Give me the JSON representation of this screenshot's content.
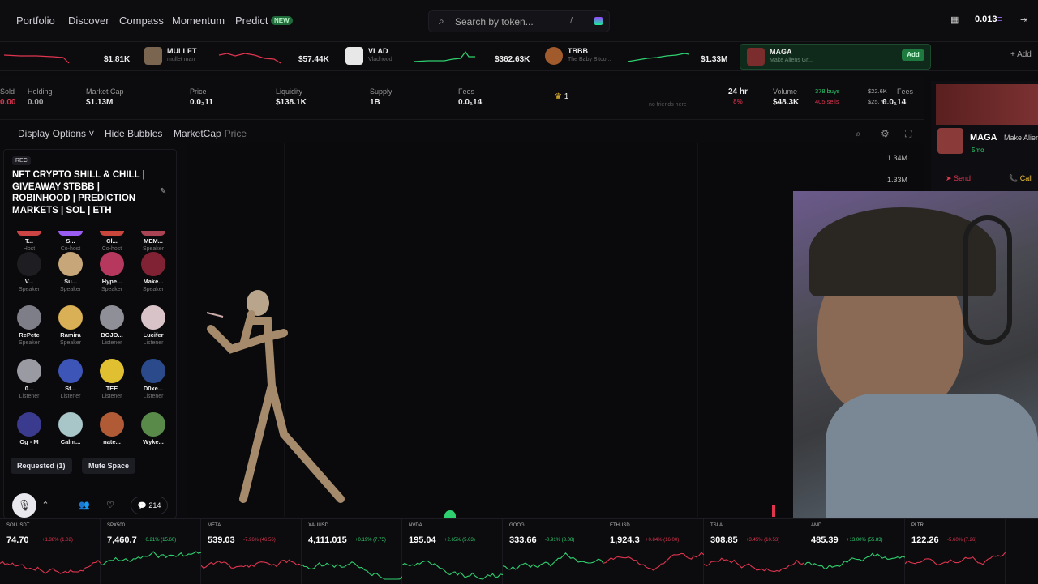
{
  "nav": {
    "items": [
      "Portfolio",
      "Discover",
      "Compass",
      "Momentum",
      "Predict"
    ],
    "new_badge": "NEW",
    "search_placeholder": "Search by token...",
    "search_shortcut": "/",
    "balance": "0.013"
  },
  "ticker": [
    {
      "name": "",
      "sub": "",
      "mc": "$1.81K",
      "trend": "down"
    },
    {
      "name": "MULLET",
      "sub": "mullet man",
      "mc": "$57.44K",
      "trend": "down"
    },
    {
      "name": "VLAD",
      "sub": "Vladhood",
      "mc": "$362.63K",
      "trend": "up"
    },
    {
      "name": "TBBB",
      "sub": "The Baby Bitco...",
      "mc": "$1.33M",
      "trend": "up"
    },
    {
      "name": "MAGA",
      "sub": "Make Aliens Gr...",
      "mc": "",
      "trend": "flat"
    }
  ],
  "ticker_add": "Add",
  "ticker_add_more": "Add",
  "stats": {
    "sold_label": "Sold",
    "sold_value": "0.00",
    "holding_label": "Holding",
    "holding_value": "0.00",
    "mcap_label": "Market Cap",
    "mcap_value": "$1.13M",
    "price_label": "Price",
    "price_value": "0.0₂11",
    "liq_label": "Liquidity",
    "liq_value": "$138.1K",
    "supply_label": "Supply",
    "supply_value": "1B",
    "fees_label": "Fees",
    "fees_value": "0.0₁14",
    "holders_count": "1",
    "friends": "no friends here",
    "period": "24 hr",
    "period_change": "8%",
    "volume_label": "Volume",
    "volume_value": "$48.3K",
    "buys": "378 buys",
    "buys_value": "$22.6K",
    "sells": "405 sells",
    "sells_value": "$25.7K",
    "fees2_label": "Fees",
    "fees2_value": "0.0₁14"
  },
  "toolbar": {
    "display_options": "Display Options",
    "hide_bubbles": "Hide Bubbles",
    "mcap": "MarketCap",
    "price": "/ Price"
  },
  "chart": {
    "y_labels": [
      "1.34M",
      "1.33M"
    ]
  },
  "space": {
    "rec": "REC",
    "title": "NFT CRYPTO SHILL & CHILL | GIVEAWAY $TBBB | ROBINHOOD | PREDICTION MARKETS | SOL | ETH",
    "speakers": [
      {
        "name": "T...",
        "role": "Host"
      },
      {
        "name": "S...",
        "role": "Co-host"
      },
      {
        "name": "Cl...",
        "role": "Co-host"
      },
      {
        "name": "MEM...",
        "role": "Speaker"
      },
      {
        "name": "V...",
        "role": "Speaker"
      },
      {
        "name": "Su...",
        "role": "Speaker"
      },
      {
        "name": "Hype...",
        "role": "Speaker"
      },
      {
        "name": "Make...",
        "role": "Speaker"
      },
      {
        "name": "RePete",
        "role": "Speaker"
      },
      {
        "name": "Ramira",
        "role": "Speaker"
      },
      {
        "name": "BOJO...",
        "role": "Listener"
      },
      {
        "name": "Lucifer",
        "role": "Listener"
      },
      {
        "name": "0...",
        "role": "Listener"
      },
      {
        "name": "St...",
        "role": "Listener"
      },
      {
        "name": "TEE",
        "role": "Listener"
      },
      {
        "name": "D0xe...",
        "role": "Listener"
      },
      {
        "name": "Og - M",
        "role": ""
      },
      {
        "name": "Calm...",
        "role": ""
      },
      {
        "name": "nate...",
        "role": ""
      },
      {
        "name": "Wyke...",
        "role": ""
      }
    ],
    "requested": "Requested (1)",
    "mute": "Mute Space",
    "comments": "214"
  },
  "side": {
    "name": "MAGA",
    "sub": "Make Alien",
    "age": "5mo",
    "send": "Send",
    "call": "Call"
  },
  "bottom": [
    {
      "ticker": "SOLUSDT",
      "price": "74.70",
      "change": "+1.38% (1.02)",
      "color": "#e0354f"
    },
    {
      "ticker": "SPX500",
      "price": "7,460.7",
      "change": "+0.21% (15.60)",
      "color": "#2fd06f"
    },
    {
      "ticker": "META",
      "price": "539.03",
      "change": "-7.96% (46.56)",
      "color": "#e0354f"
    },
    {
      "ticker": "XAUUSD",
      "price": "4,111.015",
      "change": "+0.19% (7.75)",
      "color": "#2fd06f"
    },
    {
      "ticker": "NVDA",
      "price": "195.04",
      "change": "+2.65% (5.03)",
      "color": "#2fd06f"
    },
    {
      "ticker": "GOOGL",
      "price": "333.66",
      "change": "-0.91% (3.08)",
      "color": "#2fd06f"
    },
    {
      "ticker": "ETHUSD",
      "price": "1,924.3",
      "change": "+0.84% (16.00)",
      "color": "#e0354f"
    },
    {
      "ticker": "TSLA",
      "price": "308.85",
      "change": "+3.45% (10.53)",
      "color": "#e0354f"
    },
    {
      "ticker": "AMD",
      "price": "485.39",
      "change": "+13.00% (55.83)",
      "color": "#2fd06f"
    },
    {
      "ticker": "PLTR",
      "price": "122.26",
      "change": "-5.60% (7.26)",
      "color": "#e0354f"
    }
  ]
}
